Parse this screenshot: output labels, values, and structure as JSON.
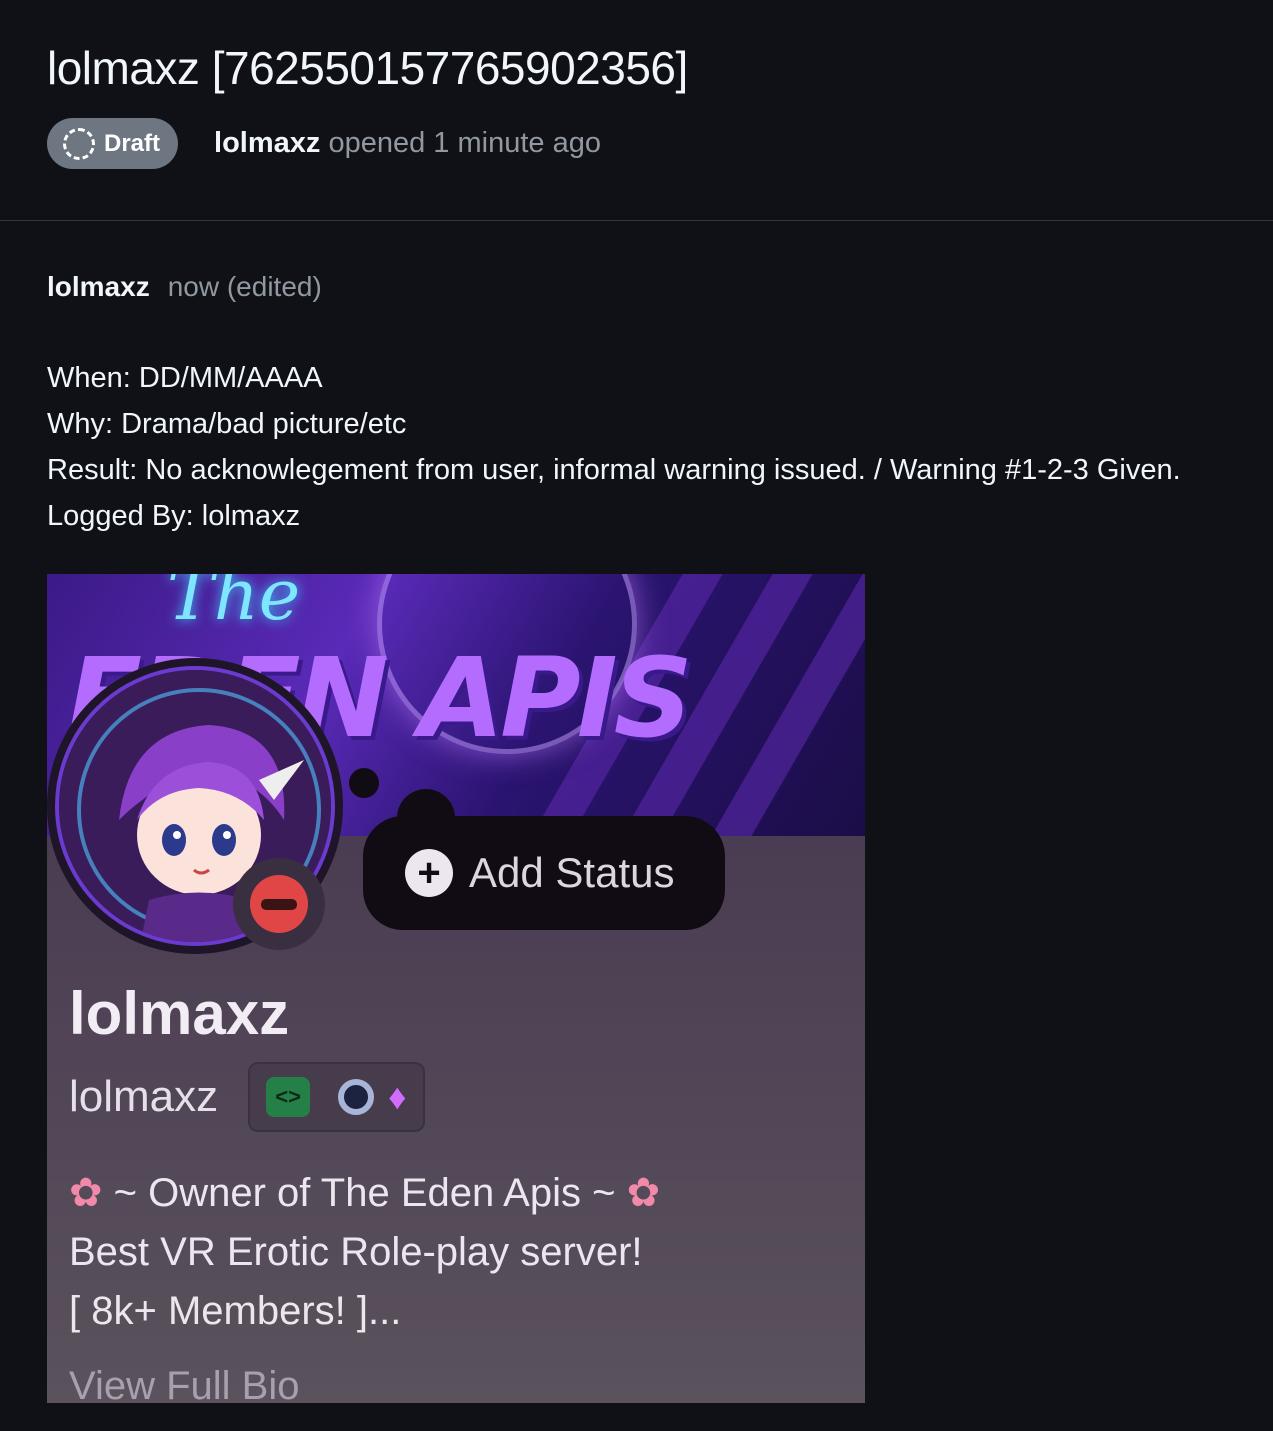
{
  "header": {
    "title": "lolmaxz [762550157765902356]",
    "draft_label": "Draft",
    "opened_user": "lolmaxz",
    "opened_text": "opened 1 minute ago"
  },
  "comment": {
    "author": "lolmaxz",
    "time": "now (edited)",
    "lines": [
      "When: DD/MM/AAAA",
      "Why: Drama/bad picture/etc",
      "Result: No acknowlegement from user, informal warning issued. / Warning #1-2-3 Given.",
      "Logged By: lolmaxz"
    ]
  },
  "profile_card": {
    "banner_script": "The",
    "banner_logo": "EDEN APIS",
    "add_status_label": "Add Status",
    "display_name": "lolmaxz",
    "username": "lolmaxz",
    "badge_icons": [
      "developer-badge-icon",
      "quest-orb-badge-icon",
      "gem-badge-icon"
    ],
    "bio_line1": "~ Owner of The Eden Apis ~",
    "bio_line2": "Best VR Erotic Role-play server!",
    "bio_line3": "[ 8k+ Members! ]...",
    "view_bio": "View Full Bio"
  }
}
